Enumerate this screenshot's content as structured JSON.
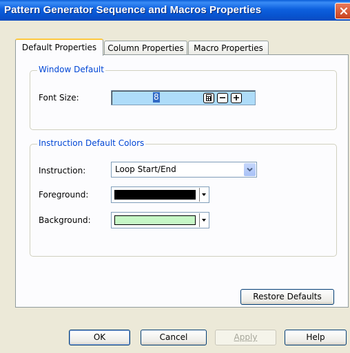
{
  "window": {
    "title": "Pattern Generator Sequence and Macros Properties"
  },
  "tabs": [
    {
      "label": "Default Properties",
      "active": true
    },
    {
      "label": "Column Properties",
      "active": false
    },
    {
      "label": "Macro Properties",
      "active": false
    }
  ],
  "window_default": {
    "group_label": "Window Default",
    "font_size_label": "Font Size:",
    "font_size_value": "8"
  },
  "instruction_colors": {
    "group_label": "Instruction Default Colors",
    "instruction_label": "Instruction:",
    "instruction_value": "Loop Start/End",
    "foreground_label": "Foreground:",
    "foreground_color": "#000000",
    "background_label": "Background:",
    "background_color": "#C6F7C6"
  },
  "restore_defaults_label": "Restore Defaults",
  "footer": {
    "ok_label": "OK",
    "cancel_label": "Cancel",
    "apply_label": "Apply",
    "help_label": "Help"
  },
  "colors": {
    "title_bar": "#0A5DD8",
    "group_label": "#0046D5",
    "spin_field": "#AEDCF9"
  }
}
